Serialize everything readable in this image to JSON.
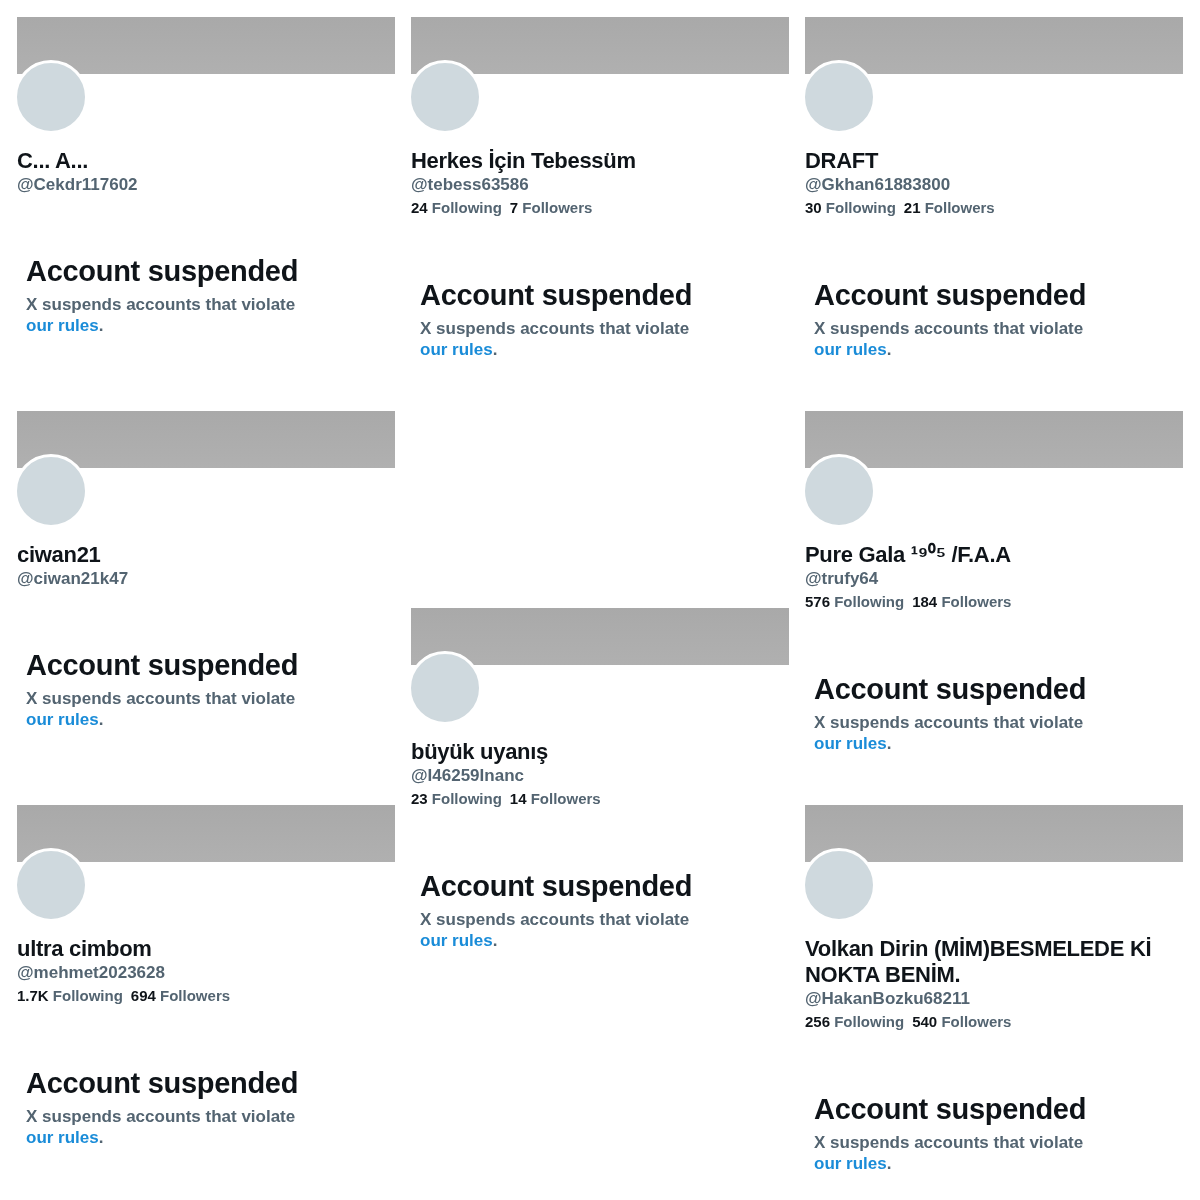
{
  "columns": [
    {
      "cards": [
        {
          "name": "C... A...",
          "handle": "@Cekdr117602",
          "title": "Account suspended",
          "message": "X suspends accounts that violate",
          "link": "our rules",
          "message_end": "."
        },
        {
          "name": "ciwan21",
          "handle": "@ciwan21k47",
          "title": "Account suspended",
          "message": "X suspends accounts that violate",
          "link": "our rules",
          "message_end": "."
        },
        {
          "name": "ultra cimbom",
          "handle": "@mehmet2023628",
          "stats": [
            {
              "count": "1.7K",
              "label": "Following"
            },
            {
              "count": "694",
              "label": "Followers"
            }
          ],
          "title": "Account suspended",
          "message": "X suspends accounts that violate",
          "link": "our rules",
          "message_end": "."
        }
      ]
    },
    {
      "cards": [
        {
          "name": "Herkes İçin Tebessüm",
          "handle": "@tebess63586",
          "stats": [
            {
              "count": "24",
              "label": "Following"
            },
            {
              "count": "7",
              "label": "Followers"
            }
          ],
          "title": "Account suspended",
          "message": "X suspends accounts that violate",
          "link": "our rules",
          "message_end": "."
        },
        {
          "name": "büyük uyanış",
          "handle": "@I46259Inanc",
          "stats": [
            {
              "count": "23",
              "label": "Following"
            },
            {
              "count": "14",
              "label": "Followers"
            }
          ],
          "title": "Account suspended",
          "message": "X suspends accounts that violate",
          "link": "our rules",
          "message_end": "."
        }
      ]
    },
    {
      "cards": [
        {
          "name": "DRAFT",
          "handle": "@Gkhan61883800",
          "stats": [
            {
              "count": "30",
              "label": "Following"
            },
            {
              "count": "21",
              "label": "Followers"
            }
          ],
          "title": "Account suspended",
          "message": "X suspends accounts that violate",
          "link": "our rules",
          "message_end": "."
        },
        {
          "name": "Pure Gala ¹⁹⁰⁵ /F.A.A",
          "handle": "@trufy64",
          "stats": [
            {
              "count": "576",
              "label": "Following"
            },
            {
              "count": "184",
              "label": "Followers"
            }
          ],
          "title": "Account suspended",
          "message": "X suspends accounts that violate",
          "link": "our rules",
          "message_end": "."
        },
        {
          "name": "Volkan Dirin (MİM)BESMELEDE Kİ NOKTA BENİM.",
          "handle": "@HakanBozku68211",
          "stats": [
            {
              "count": "256",
              "label": "Following"
            },
            {
              "count": "540",
              "label": "Followers"
            }
          ],
          "title": "Account suspended",
          "message": "X suspends accounts that violate",
          "link": "our rules",
          "message_end": "."
        }
      ]
    }
  ]
}
